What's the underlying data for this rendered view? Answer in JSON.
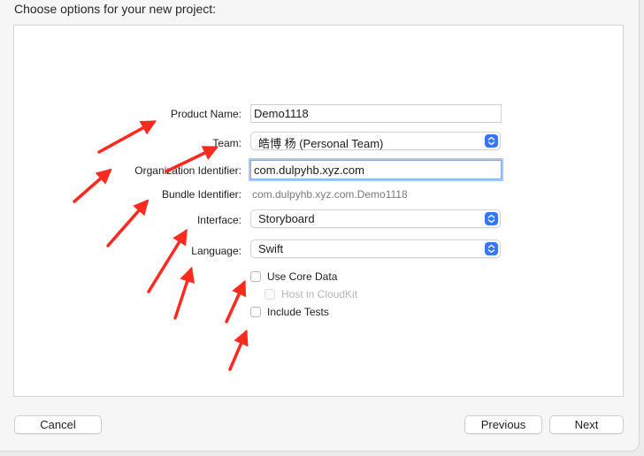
{
  "dialog": {
    "title": "Choose options for your new project:"
  },
  "form": {
    "product_name": {
      "label": "Product Name:",
      "value": "Demo1118"
    },
    "team": {
      "label": "Team:",
      "value": "皓博 杨 (Personal Team)"
    },
    "organization_identifier": {
      "label": "Organization Identifier:",
      "value": "com.dulpyhb.xyz.com"
    },
    "bundle_identifier": {
      "label": "Bundle Identifier:",
      "value": "com.dulpyhb.xyz.com.Demo1118"
    },
    "interface": {
      "label": "Interface:",
      "value": "Storyboard"
    },
    "language": {
      "label": "Language:",
      "value": "Swift"
    },
    "use_core_data": {
      "label": "Use Core Data",
      "checked": false
    },
    "host_in_cloudkit": {
      "label": "Host in CloudKit",
      "checked": false,
      "enabled": false
    },
    "include_tests": {
      "label": "Include Tests",
      "checked": false
    }
  },
  "buttons": {
    "cancel": "Cancel",
    "previous": "Previous",
    "next": "Next"
  },
  "colors": {
    "accent": "#3478f6",
    "annotation_arrow": "#ff2a1f"
  }
}
